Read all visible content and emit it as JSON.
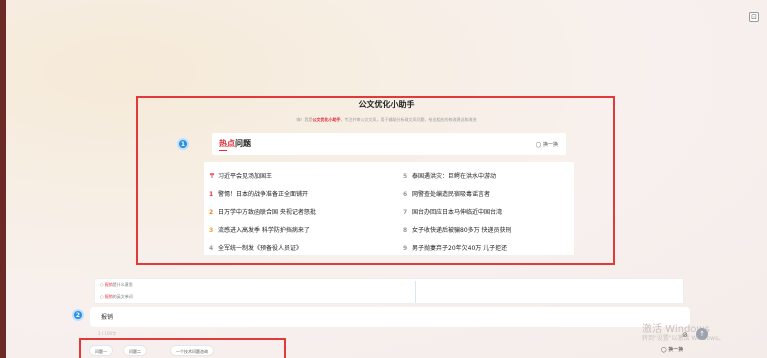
{
  "window_button": "⊡",
  "header": {
    "title": "公文优化小助手",
    "subtitle_prefix": "嗨！我是",
    "subtitle_highlight": "公文优化小助手",
    "subtitle_suffix": "，专注并审公文文风，用于辅助分析政文风问题，给出相应的修改建议和改进"
  },
  "markers": {
    "one": "1",
    "two": "2"
  },
  "hot": {
    "title_red": "热点",
    "title_black": "问题",
    "refresh_label": "换一换",
    "items": [
      {
        "num": "〒",
        "text": "习近平会见汤加国王",
        "color": "#e0303a"
      },
      {
        "num": "5",
        "text": "泰国遇洪灾：巨鳄在洪水中游动",
        "color": "#999999"
      },
      {
        "num": "1",
        "text": "警惕！日本的战争准备正全面铺开",
        "color": "#e0303a"
      },
      {
        "num": "6",
        "text": "网警查处编造民宿吸毒谣言者",
        "color": "#999999"
      },
      {
        "num": "2",
        "text": "日万学中方致函联合国 央视记者怒批",
        "color": "#f07a20"
      },
      {
        "num": "7",
        "text": "国台办回应日本马伸临近中国台湾",
        "color": "#999999"
      },
      {
        "num": "3",
        "text": "流感进入高发季 科学防护挡病来了",
        "color": "#f0a020"
      },
      {
        "num": "8",
        "text": "女子收快递后被骗80多万 快递员获刑",
        "color": "#999999"
      },
      {
        "num": "4",
        "text": "全军统一制发《预备役人员证》",
        "color": "#999999"
      },
      {
        "num": "9",
        "text": "男子抛妻弃子20年欠40万 儿子拒还",
        "color": "#999999"
      }
    ]
  },
  "suggestions": [
    {
      "red": "报销",
      "rest": "是什么意思"
    },
    {
      "red": "报销",
      "rest": "的英文单词"
    }
  ],
  "input": {
    "value": "报销",
    "counter": "2 / 100字"
  },
  "chips": [
    "问题一",
    "问题二",
    "一个技术问题咨询"
  ],
  "watermark": {
    "line1": "激活 Windows",
    "line2": "转到\"设置\"以激活 Windows。"
  },
  "bottom": {
    "refresh_label": "换一换",
    "send_icon": "↑",
    "attach_icon": "⊘"
  }
}
